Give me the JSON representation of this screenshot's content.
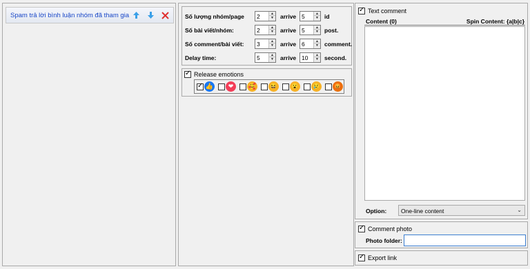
{
  "task": {
    "title": "Spam trả lời bình luận nhóm đã tham gia",
    "up_icon": "arrow-up-icon",
    "down_icon": "arrow-down-icon",
    "delete_icon": "close-icon"
  },
  "settings": {
    "rows": [
      {
        "label": "Số lượng nhóm/page",
        "from": "2",
        "arrive": "arrive",
        "to": "5",
        "unit": "id"
      },
      {
        "label": "Số bài viết/nhóm:",
        "from": "2",
        "arrive": "arrive",
        "to": "5",
        "unit": "post."
      },
      {
        "label": "Số comment/bài viết:",
        "from": "3",
        "arrive": "arrive",
        "to": "6",
        "unit": "comment."
      },
      {
        "label": "Delay time:",
        "from": "5",
        "arrive": "arrive",
        "to": "10",
        "unit": "second."
      }
    ]
  },
  "emotions": {
    "label": "Release emotions",
    "enabled": true,
    "items": [
      {
        "name": "like",
        "checked": true,
        "color": "#1877f2",
        "glyph": "👍"
      },
      {
        "name": "love",
        "checked": false,
        "color": "#f33e58",
        "glyph": "❤"
      },
      {
        "name": "care",
        "checked": false,
        "color": "#f7b125",
        "glyph": "🥰"
      },
      {
        "name": "haha",
        "checked": false,
        "color": "#f7b125",
        "glyph": "😆"
      },
      {
        "name": "wow",
        "checked": false,
        "color": "#f7b125",
        "glyph": "😮"
      },
      {
        "name": "sad",
        "checked": false,
        "color": "#f7b125",
        "glyph": "😢"
      },
      {
        "name": "angry",
        "checked": false,
        "color": "#e9710f",
        "glyph": "😡"
      }
    ]
  },
  "text_comment": {
    "label": "Text comment",
    "enabled": true,
    "content_header": "Content (0)",
    "spin_header": "Spin Content: {a|b|c}",
    "content_value": "",
    "option_label": "Option:",
    "option_value": "One-line content"
  },
  "comment_photo": {
    "label": "Comment photo",
    "enabled": true,
    "folder_label": "Photo folder:",
    "folder_value": ""
  },
  "export_link": {
    "label": "Export link",
    "enabled": true
  }
}
